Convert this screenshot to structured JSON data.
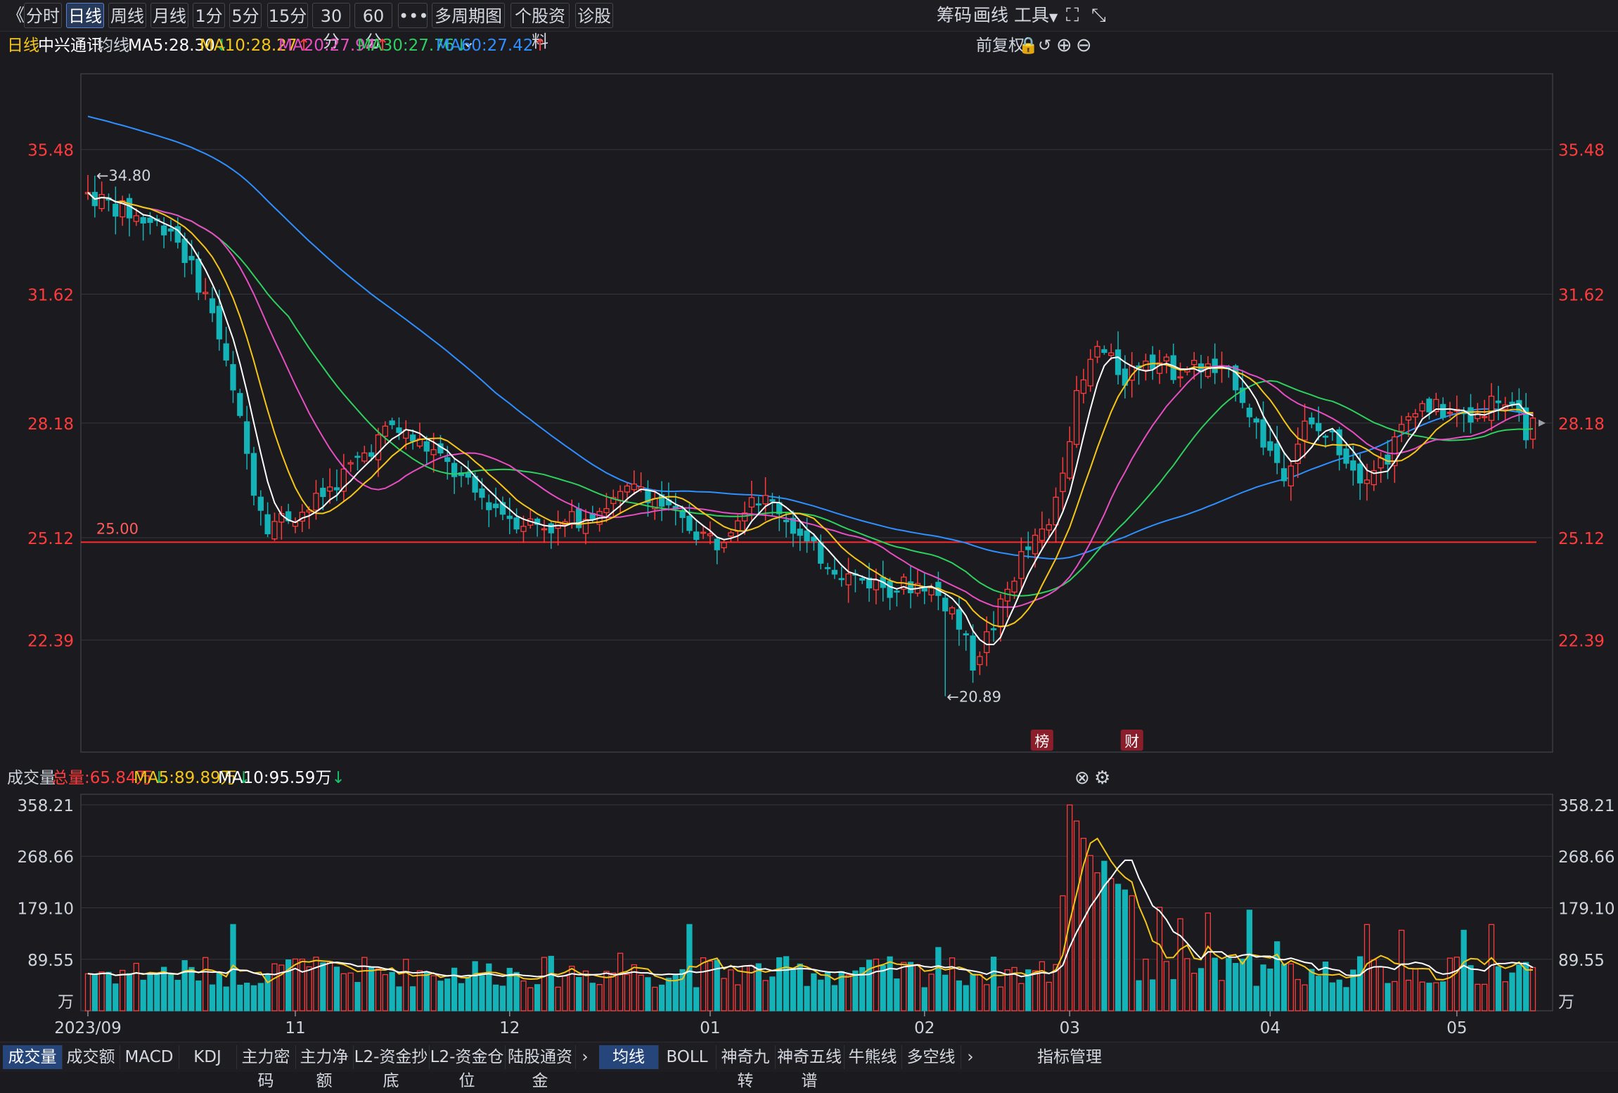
{
  "toolbar": {
    "back": "《",
    "tabs": [
      "分时",
      "日线",
      "周线",
      "月线",
      "1分",
      "5分",
      "15分",
      "30分",
      "60分",
      "•••",
      "多周期图",
      "个股资料",
      "诊股"
    ],
    "active_tab": "日线",
    "right": [
      "筹码",
      "画线",
      "工具"
    ]
  },
  "info": {
    "period": "日线",
    "stock": "中兴通讯",
    "ma_label": "均线",
    "ma5": "MA5:28.30",
    "ma10": "MA10:28.27",
    "ma20": "MA20:27.94",
    "ma30": "MA30:27.76",
    "ma60": "MA60:27.42",
    "fq": "前复权"
  },
  "colors": {
    "ma5": "#ffffff",
    "ma10": "#f5c518",
    "ma20": "#e64ec2",
    "ma30": "#2fcf5e",
    "ma60": "#2f8fff",
    "up": "#ff3b3b",
    "down": "#14b3b8",
    "price_axis": "#ff3b3b"
  },
  "volume_info": {
    "label": "成交量",
    "total": "总量:65.84万",
    "ma5": "MA5:89.89万",
    "ma10": "MA10:95.59万"
  },
  "chart_data": [
    {
      "type": "candlestick",
      "y_ticks": [
        "35.48",
        "31.62",
        "28.18",
        "25.12",
        "22.39"
      ],
      "ylim": [
        19.4,
        37.5
      ],
      "x_ticks": [
        {
          "label": "2023/09",
          "x": 0
        },
        {
          "label": "11",
          "x": 30
        },
        {
          "label": "12",
          "x": 61
        },
        {
          "label": "01",
          "x": 90
        },
        {
          "label": "02",
          "x": 121
        },
        {
          "label": "03",
          "x": 142
        },
        {
          "label": "04",
          "x": 171
        },
        {
          "label": "05",
          "x": 198
        }
      ],
      "annotations": [
        {
          "text": "←34.80",
          "x": 1,
          "y": 34.8
        },
        {
          "text": "←20.89",
          "x": 124,
          "y": 20.89
        },
        {
          "text": "25.00",
          "x": 1,
          "y": 25.0
        }
      ],
      "markers": [
        {
          "text": "榜",
          "x": 138
        },
        {
          "text": "财",
          "x": 151
        }
      ],
      "reference_line": 25.0
    },
    {
      "type": "bar",
      "title": "成交量",
      "y_ticks": [
        "358.21",
        "268.66",
        "179.10",
        "89.55"
      ],
      "unit": "万",
      "ylim": [
        0,
        358.21
      ]
    }
  ],
  "bottom_tabs": {
    "left": [
      "成交量",
      "成交额",
      "MACD",
      "KDJ",
      "主力密码",
      "主力净额",
      "L2-资金抄底",
      "L2-资金仓位",
      "陆股通资金"
    ],
    "right": [
      "均线",
      "BOLL",
      "神奇九转",
      "神奇五线谱",
      "牛熊线",
      "多空线"
    ],
    "manage": "指标管理"
  }
}
